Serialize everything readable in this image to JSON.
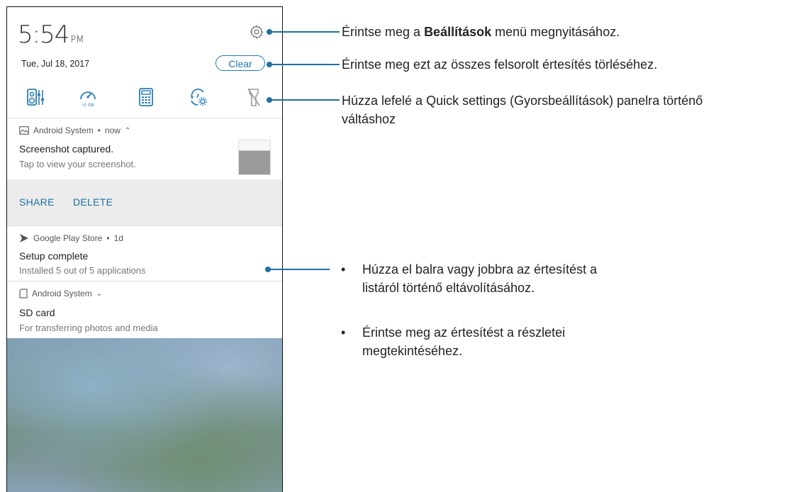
{
  "phone": {
    "time": "5:54",
    "ampm": "PM",
    "date": "Tue, Jul 18, 2017",
    "clear_label": "Clear",
    "data_badge": ">1 GB",
    "quick_settings_icons": [
      "audio-wizard-icon",
      "boost-icon",
      "calculator-icon",
      "auto-update-icon",
      "flashlight-icon"
    ],
    "notifications": [
      {
        "app": "Android System",
        "meta": "now",
        "title": "Screenshot captured.",
        "text": "Tap to view your screenshot.",
        "actions": [
          "SHARE",
          "DELETE"
        ]
      },
      {
        "app": "Google Play Store",
        "meta": "1d",
        "title": "Setup complete",
        "text": "Installed 5 out of 5 applications"
      },
      {
        "app": "Android System",
        "title": "SD card",
        "text": "For transferring photos and media"
      }
    ]
  },
  "callouts": {
    "settings_pre": "Érintse meg a ",
    "settings_bold": "Beállítások",
    "settings_post": " menü megnyitásához.",
    "clear": "Érintse meg ezt az összes felsorolt értesítés törléséhez.",
    "quick_line1": "Húzza lefelé a Quick settings (Gyorsbeállítások) panelra történő",
    "quick_line2": "váltáshoz",
    "bullet1_line1": "Húzza el balra vagy jobbra az értesítést a",
    "bullet1_line2": "listáról történő eltávolításához.",
    "bullet2_line1": "Érintse meg az értesítést a részletei",
    "bullet2_line2": "megtekintéséhez.",
    "bullet_mark": "•"
  },
  "colors": {
    "accent": "#1f6fa3",
    "clear_border": "#1f7ab0",
    "actions_bg": "#ececec"
  }
}
